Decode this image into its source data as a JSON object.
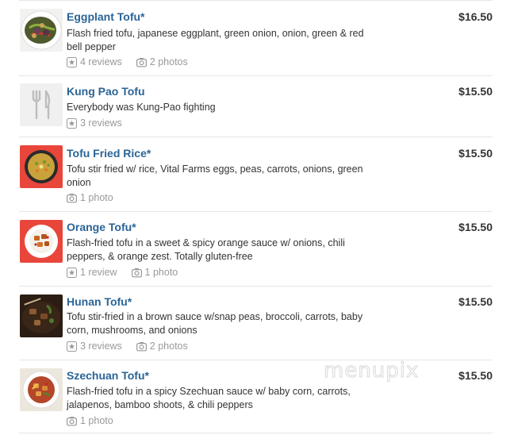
{
  "items": [
    {
      "name": "Eggplant Tofu*",
      "price": "$16.50",
      "description": "Flash fried tofu, japanese eggplant, green onion, onion, green & red bell pepper",
      "reviews": "4 reviews",
      "photos": "2 photos",
      "image": "eggplant-tofu-photo"
    },
    {
      "name": "Kung Pao Tofu",
      "price": "$15.50",
      "description": "Everybody was Kung-Pao fighting",
      "reviews": "3 reviews",
      "image": "fork-knife-placeholder-icon"
    },
    {
      "name": "Tofu Fried Rice*",
      "price": "$15.50",
      "description": "Tofu stir fried w/ rice, Vital Farms eggs, peas, carrots, onions, green onion",
      "photos": "1 photo",
      "image": "fried-rice-photo"
    },
    {
      "name": "Orange Tofu*",
      "price": "$15.50",
      "description": "Flash-fried tofu in a sweet & spicy orange sauce w/ onions, chili peppers, & orange zest. Totally gluten-free",
      "reviews": "1 review",
      "photos": "1 photo",
      "image": "orange-tofu-photo"
    },
    {
      "name": "Hunan Tofu*",
      "price": "$15.50",
      "description": "Tofu stir-fried in a brown sauce w/snap peas, broccoli, carrots, baby corn, mushrooms, and onions",
      "reviews": "3 reviews",
      "photos": "2 photos",
      "image": "hunan-tofu-photo"
    },
    {
      "name": "Szechuan Tofu*",
      "price": "$15.50",
      "description": "Flash-fried tofu in a spicy Szechuan sauce w/ baby corn, carrots, jalapenos, bamboo shoots, & chili peppers",
      "photos": "1 photo",
      "image": "szechuan-tofu-photo"
    }
  ],
  "watermark": "menupix",
  "colors": {
    "link": "#2a6496",
    "muted": "#999999",
    "divider": "#e6e6e6",
    "thumb_red": "#e8463b"
  }
}
